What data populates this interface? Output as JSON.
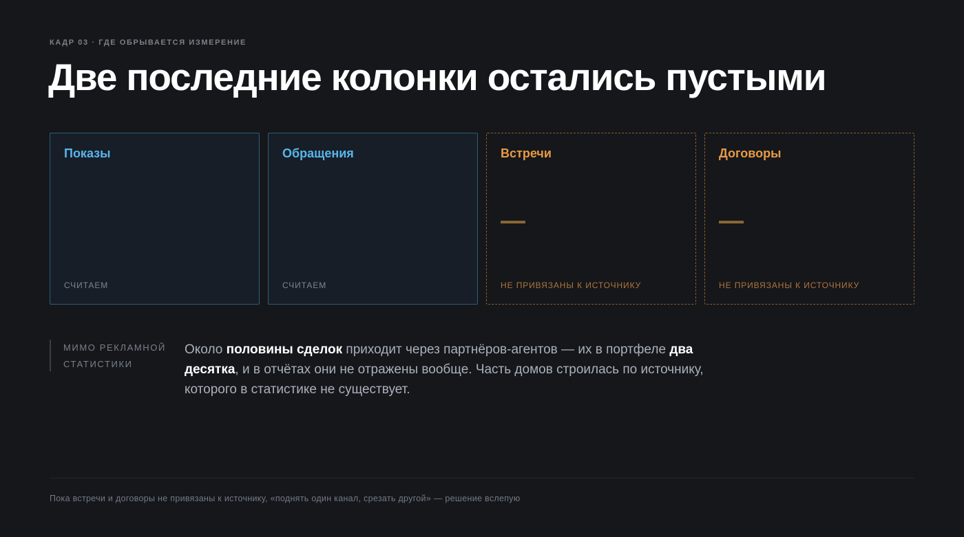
{
  "eyebrow": "КАДР 03 · ГДЕ ОБРЫВАЕТСЯ ИЗМЕРЕНИЕ",
  "title": "Две последние колонки остались пустыми",
  "cards": [
    {
      "name": "Показы",
      "status": "СЧИТАЕМ",
      "state": "counted"
    },
    {
      "name": "Обращения",
      "status": "СЧИТАЕМ",
      "state": "counted"
    },
    {
      "name": "Встречи",
      "value": "—",
      "status": "НЕ ПРИВЯЗАНЫ К ИСТОЧНИКУ",
      "state": "missing"
    },
    {
      "name": "Договоры",
      "value": "—",
      "status": "НЕ ПРИВЯЗАНЫ К ИСТОЧНИКУ",
      "state": "missing"
    }
  ],
  "note": {
    "side_line1": "МИМО РЕКЛАМНОЙ",
    "side_line2": "СТАТИСТИКИ",
    "text_part1": "Около ",
    "text_bold1": "половины сделок",
    "text_part2": " приходит через партнёров-агентов — их в портфеле ",
    "text_bold2": "два десятка",
    "text_part3": ", и в отчётах они не отражены вообще. Часть домов строилась по источнику, которого в статистике не существует."
  },
  "footer": "Пока встречи и договоры не привязаны к источнику, «поднять один канал, срезать другой» — решение вслепую",
  "colors": {
    "background": "#15171b",
    "counted_accent": "#58b6ea",
    "missing_accent": "#e89a44"
  }
}
